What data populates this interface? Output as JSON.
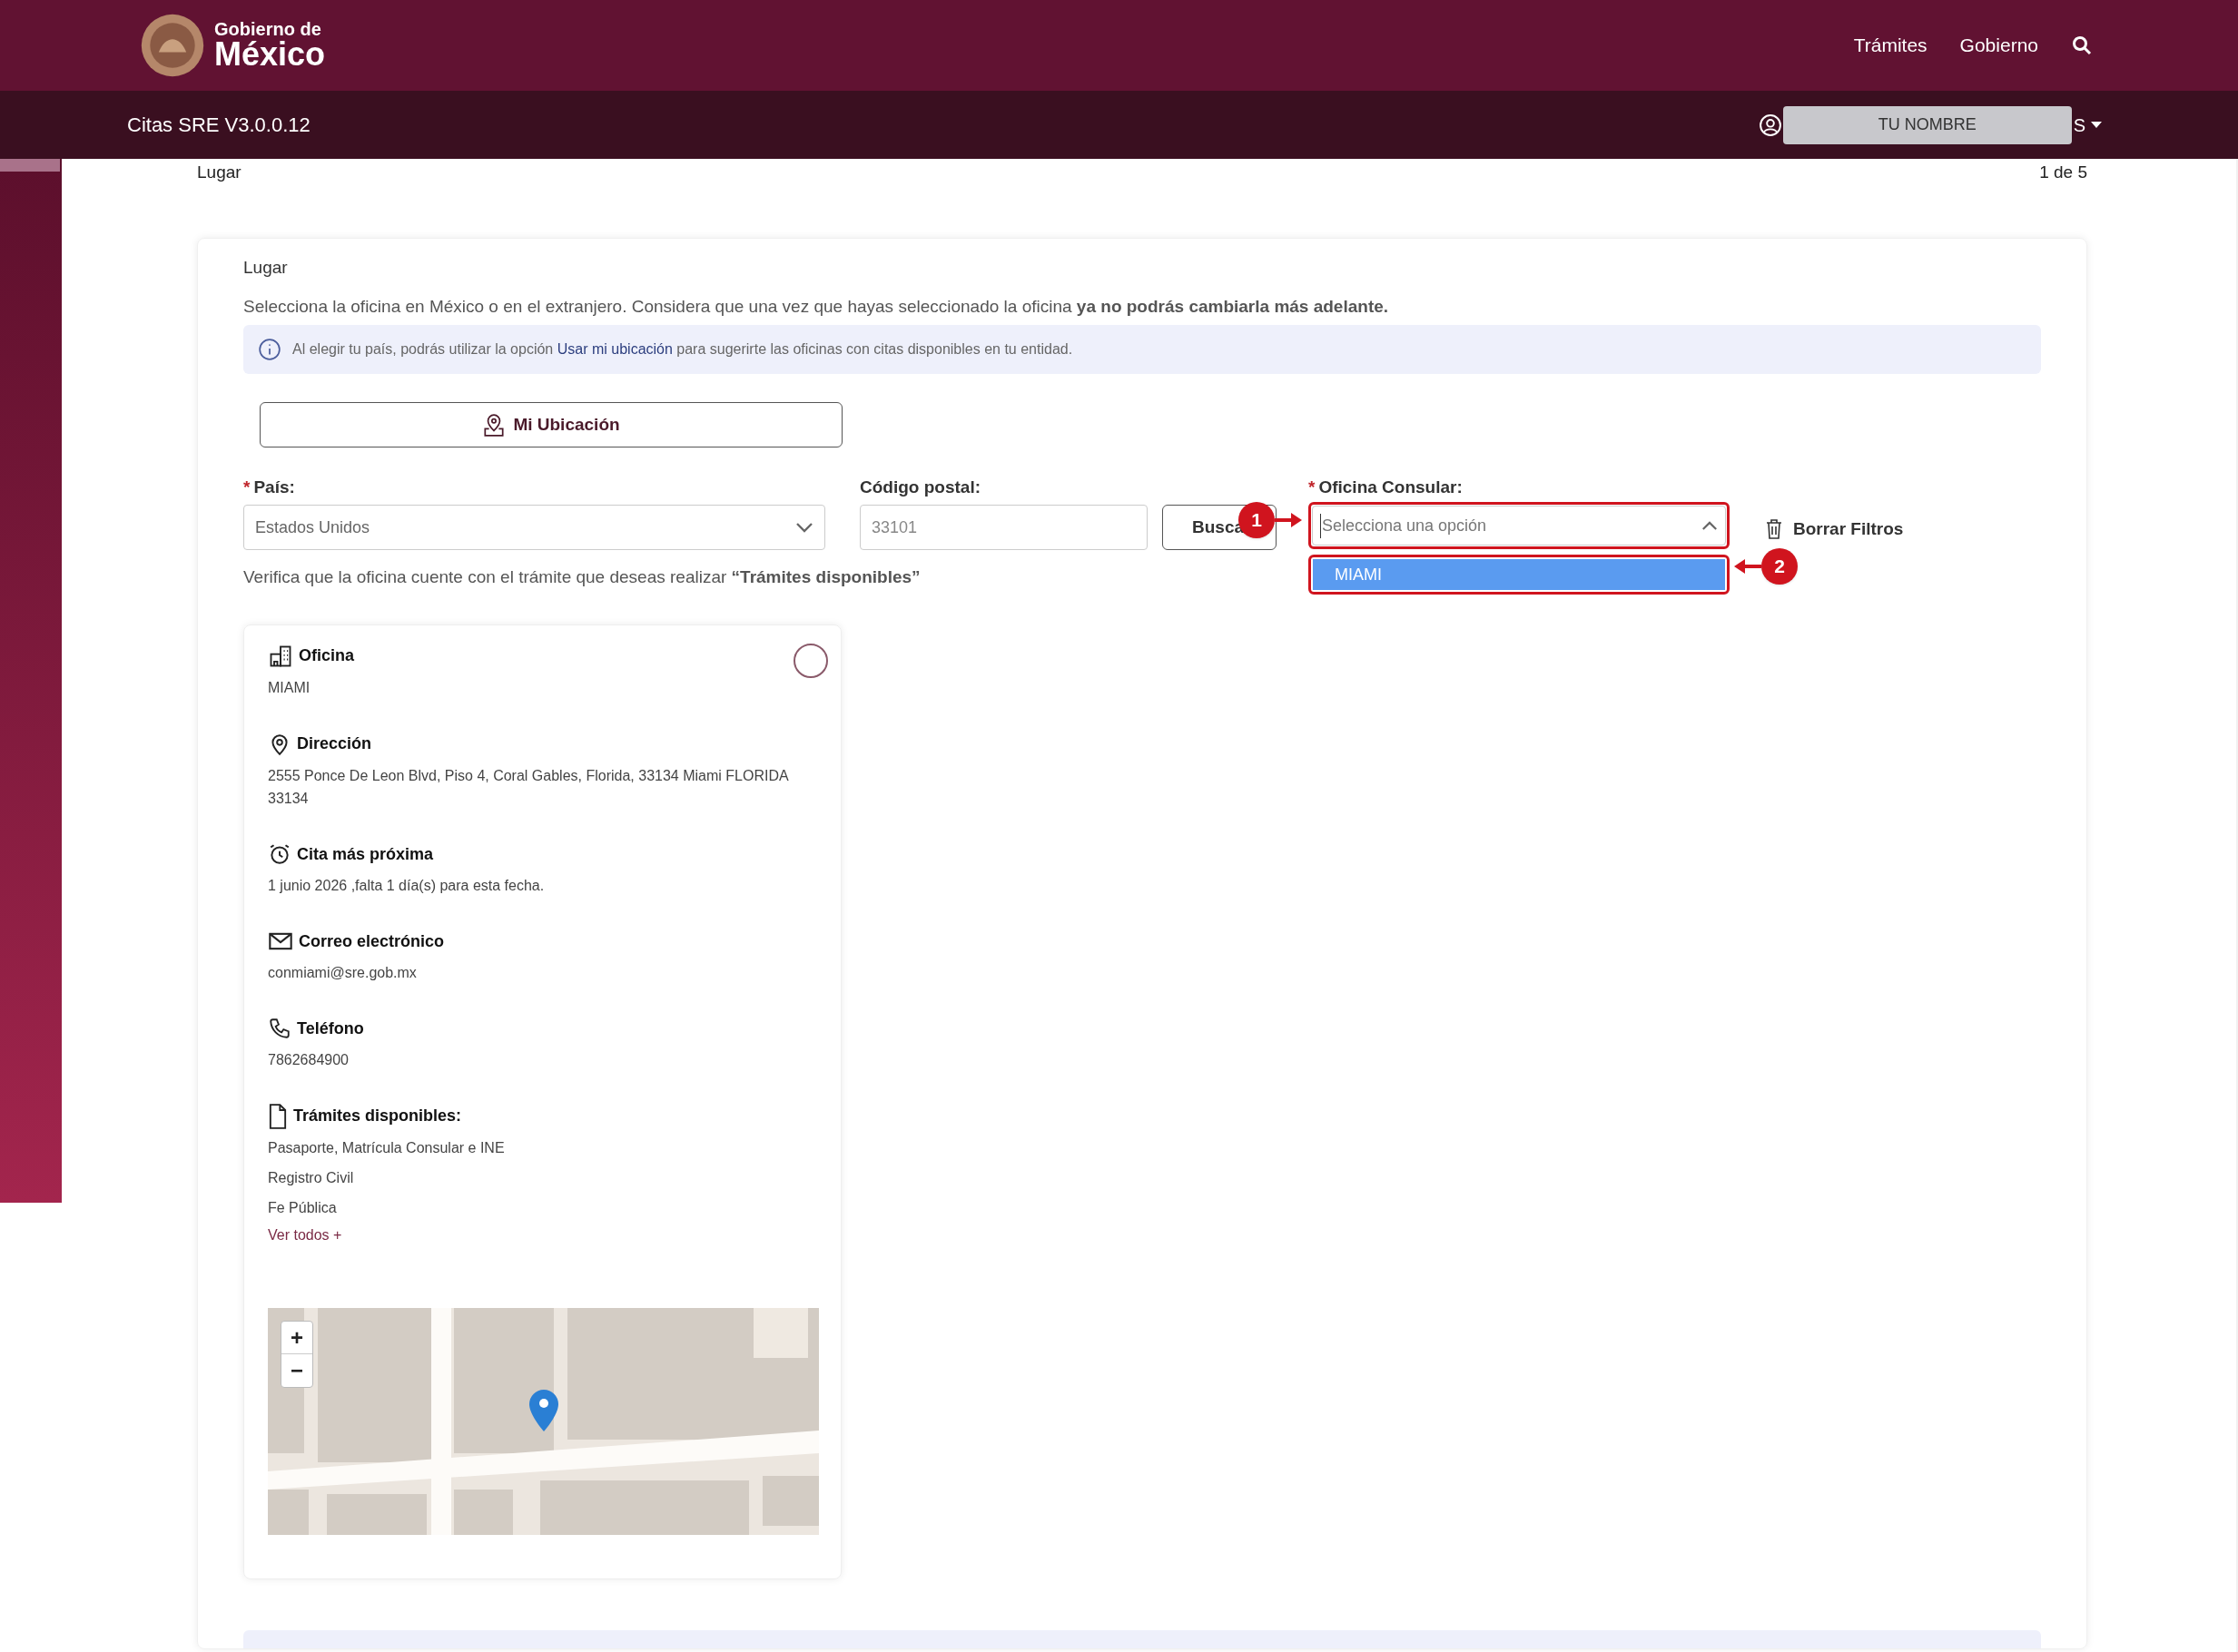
{
  "header": {
    "logo_small": "Gobierno de",
    "logo_big": "México",
    "nav": [
      {
        "label": "Trámites"
      },
      {
        "label": "Gobierno"
      }
    ]
  },
  "subheader": {
    "title": "Citas SRE V3.0.0.12",
    "user_name": "TU NOMBRE",
    "user_tail": "S"
  },
  "breadcrumb": {
    "step": "Lugar",
    "progress": "1 de 5"
  },
  "section": {
    "title": "Lugar",
    "intro": "Selecciona la oficina en México o en el extranjero. Considera que una vez que hayas seleccionado la oficina **ya no podrás cambiarla más adelante.**",
    "info": "Al elegir tu país, podrás utilizar la opción ",
    "info_link": "Usar mi ubicación",
    "info_tail": " para sugerirte las oficinas con citas disponibles en tu entidad.",
    "location_button": "Mi Ubicación",
    "country": {
      "label": "País:",
      "required_mark": "*",
      "value": "Estados Unidos"
    },
    "postal": {
      "label": "Código postal:",
      "value": "33101",
      "button": "Busca"
    },
    "office": {
      "label": "Oficina Consular:",
      "required_mark": "*",
      "placeholder": "Selecciona una opción",
      "expanded": true,
      "options": [
        {
          "label": "MIAMI",
          "selected": true
        }
      ]
    },
    "clear_button": "Borrar Filtros",
    "verify": "Verifica que la oficina cuente con el trámite que deseas realizar **“Trámites disponibles”**"
  },
  "office_card": {
    "selected": false,
    "fields": [
      {
        "kind": "building",
        "title": "Oficina",
        "lines": [
          "MIAMI"
        ]
      },
      {
        "kind": "pin",
        "title": "Dirección",
        "lines": [
          "2555 Ponce De Leon Blvd, Piso 4, Coral Gables, Florida, 33134 Miami FLORIDA 33134"
        ]
      },
      {
        "kind": "alarm",
        "title": "Cita más próxima",
        "lines": [
          "1 junio 2026 ,falta 1 día(s) para esta fecha."
        ]
      },
      {
        "kind": "mail",
        "title": "Correo electrónico",
        "lines": [
          "conmiami@sre.gob.mx"
        ]
      },
      {
        "kind": "phone",
        "title": "Teléfono",
        "lines": [
          "7862684900"
        ]
      },
      {
        "kind": "file",
        "title": "Trámites disponibles:",
        "lines": [
          "Pasaporte, Matrícula Consular e INE",
          "Registro Civil",
          "Fe Pública"
        ]
      }
    ],
    "more_link": "Ver todos +",
    "map": {
      "kind": "picture",
      "zoom_in": "+",
      "zoom_out": "−"
    }
  },
  "callouts": [
    {
      "number": "1"
    },
    {
      "number": "2"
    }
  ]
}
